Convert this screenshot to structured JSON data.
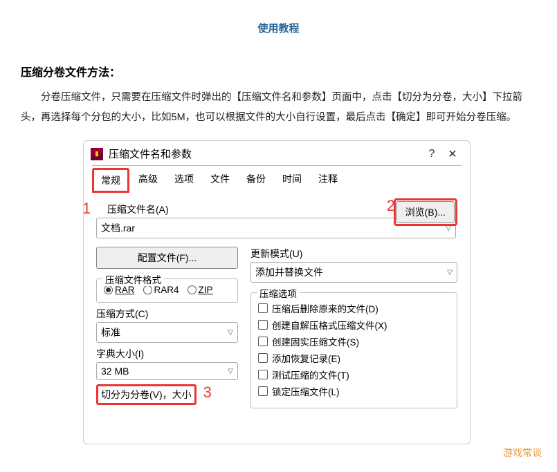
{
  "page": {
    "heading": "使用教程",
    "section_title": "压缩分卷文件方法：",
    "paragraph": "分卷压缩文件，只需要在压缩文件时弹出的【压缩文件名和参数】页面中，点击【切分为分卷，大小】下拉箭头，再选择每个分包的大小，比如5M，也可以根据文件的大小自行设置，最后点击【确定】即可开始分卷压缩。"
  },
  "dialog": {
    "title": "压缩文件名和参数",
    "help": "?",
    "close": "✕",
    "tabs": [
      "常规",
      "高级",
      "选项",
      "文件",
      "备份",
      "时间",
      "注释"
    ],
    "markers": {
      "one": "1",
      "two": "2",
      "three": "3"
    },
    "archive_name_label": "压缩文件名(A)",
    "archive_name_value": "文档.rar",
    "browse": "浏览(B)...",
    "profiles_btn": "配置文件(F)...",
    "update_mode_label": "更新模式(U)",
    "update_mode_value": "添加并替换文件",
    "format_group": "压缩文件格式",
    "formats": {
      "rar": "RAR",
      "rar4": "RAR4",
      "zip": "ZIP"
    },
    "method_label": "压缩方式(C)",
    "method_value": "标准",
    "dict_label": "字典大小(I)",
    "dict_value": "32 MB",
    "split_label": "切分为分卷(V)，大小",
    "options_group": "压缩选项",
    "options": {
      "del": "压缩后删除原来的文件(D)",
      "sfx": "创建自解压格式压缩文件(X)",
      "solid": "创建固实压缩文件(S)",
      "rr": "添加恢复记录(E)",
      "test": "测试压缩的文件(T)",
      "lock": "锁定压缩文件(L)"
    }
  },
  "watermark": "游戏常谈"
}
